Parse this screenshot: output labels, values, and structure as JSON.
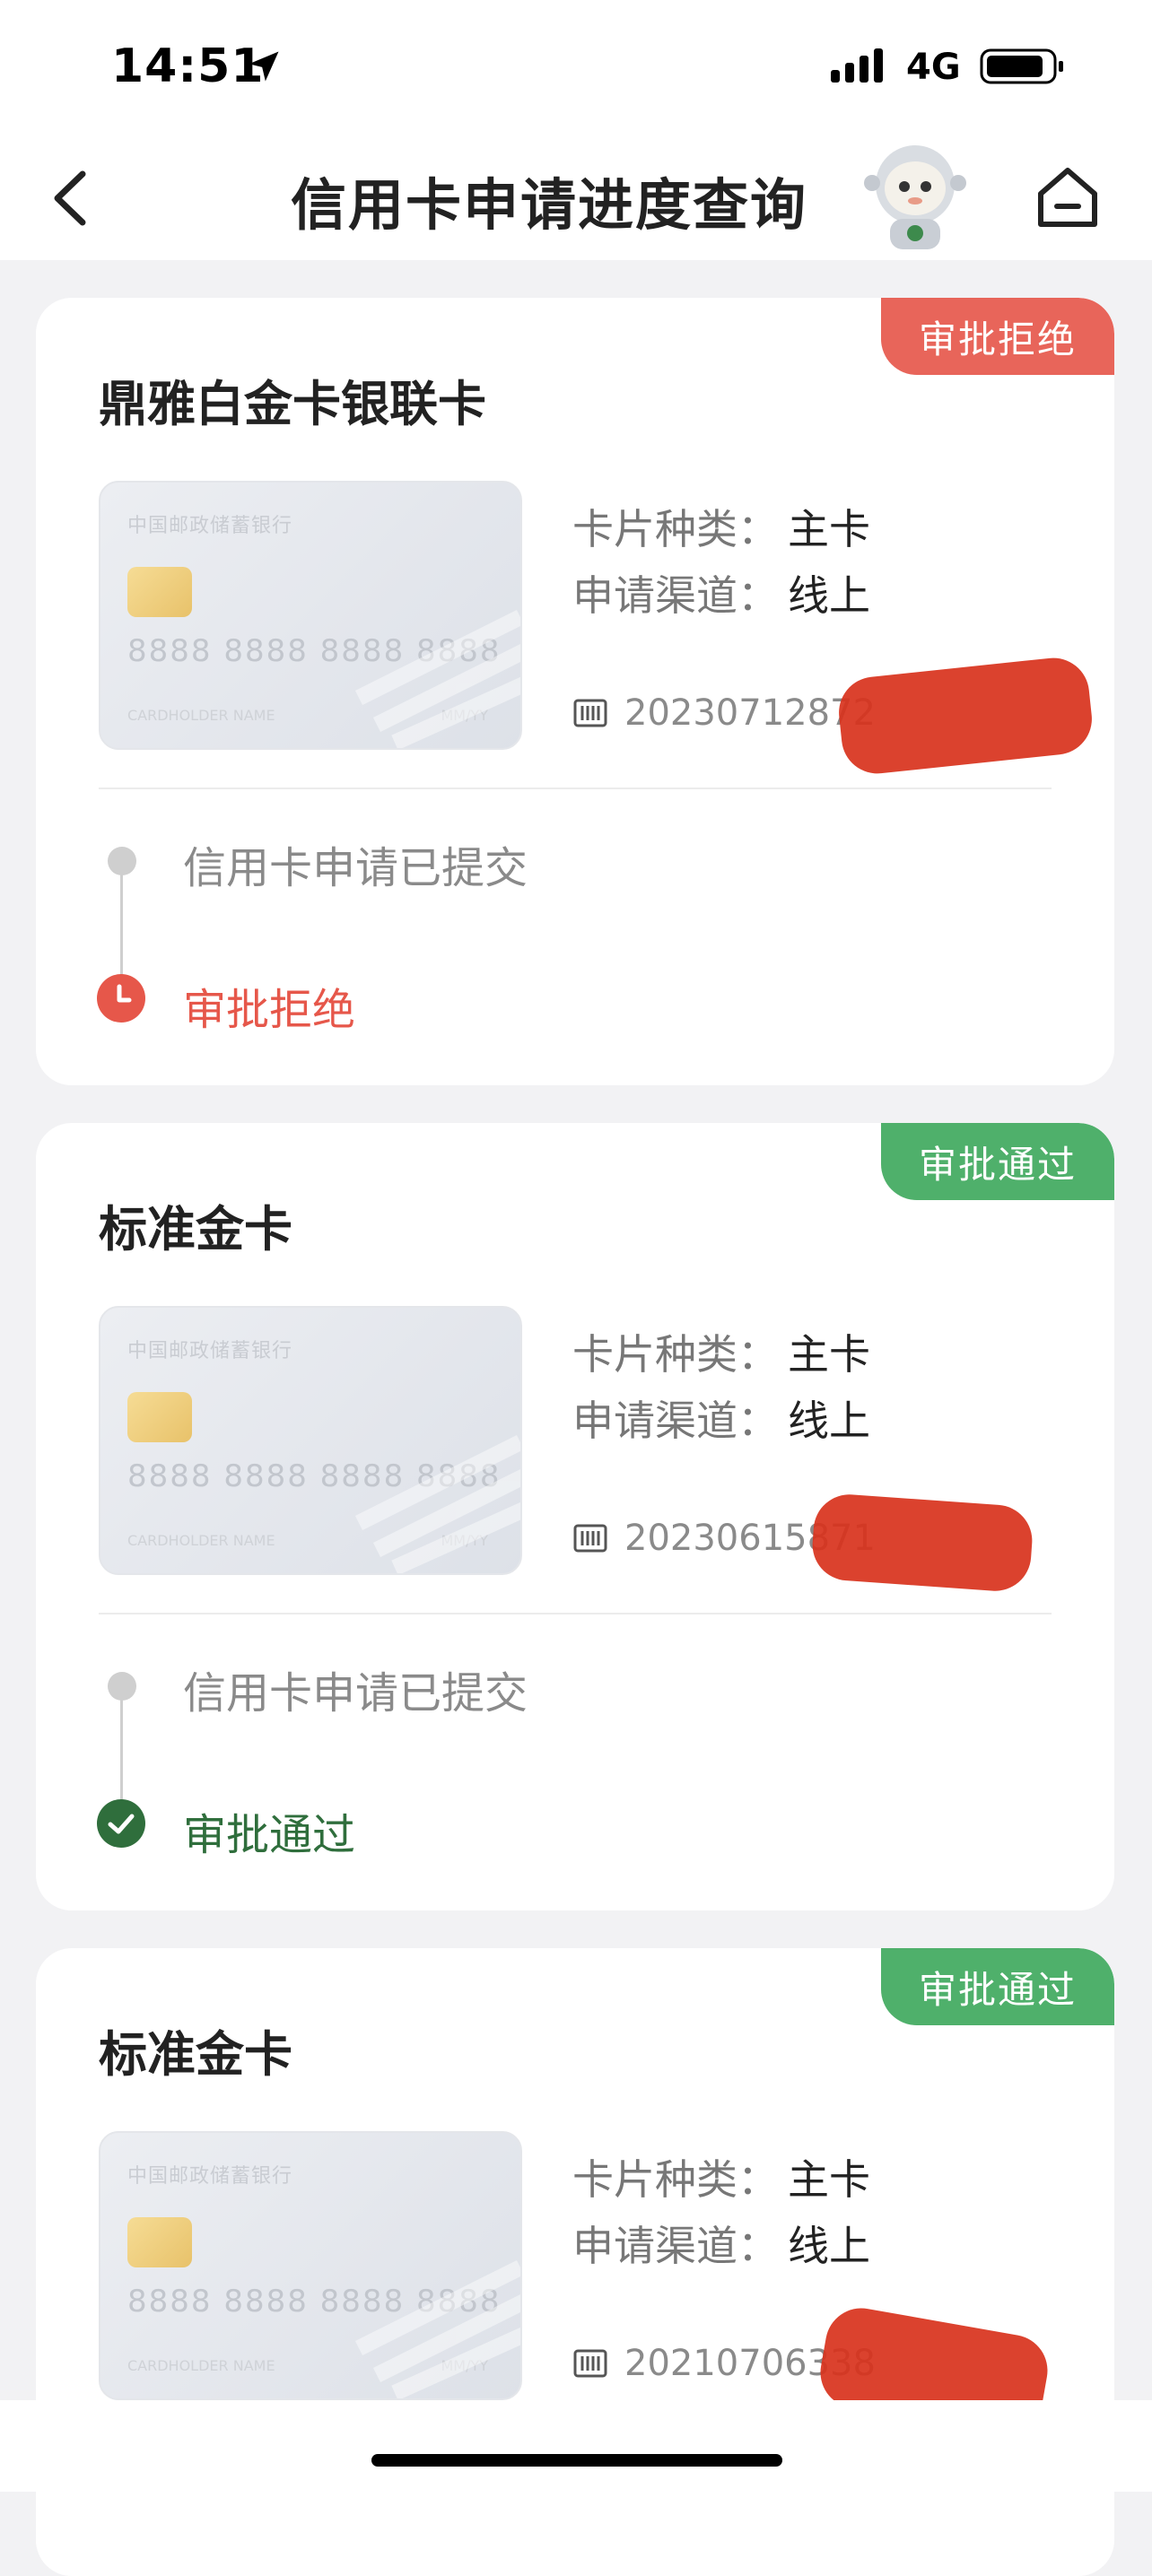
{
  "status_bar": {
    "time": "14:51",
    "network": "4G",
    "icons": [
      "location-arrow-icon",
      "signal-icon",
      "battery-icon"
    ]
  },
  "nav": {
    "title": "信用卡申请进度查询",
    "back_icon": "chevron-left-icon",
    "home_icon": "home-icon",
    "mascot": "mascot-astronaut"
  },
  "colors": {
    "reject": "#e8655a",
    "pass": "#4fb06b",
    "pass_text": "#2f6e3c",
    "redaction": "#d8321c"
  },
  "card_template": {
    "bank_name": "中国邮政储蓄银行",
    "number": "8888 8888 8888 8888",
    "holder": "CARDHOLDER NAME",
    "expiry": "MM/YY"
  },
  "labels": {
    "card_type": "卡片种类：",
    "channel": "申请渠道："
  },
  "applications": [
    {
      "status": "审批拒绝",
      "status_type": "reject",
      "card_name": "鼎雅白金卡银联卡",
      "card_type": "主卡",
      "channel": "线上",
      "app_no_visible": "20230712872",
      "steps": [
        "信用卡申请已提交",
        "审批拒绝"
      ]
    },
    {
      "status": "审批通过",
      "status_type": "pass",
      "card_name": "标准金卡",
      "card_type": "主卡",
      "channel": "线上",
      "app_no_visible": "20230615871",
      "steps": [
        "信用卡申请已提交",
        "审批通过"
      ]
    },
    {
      "status": "审批通过",
      "status_type": "pass",
      "card_name": "标准金卡",
      "card_type": "主卡",
      "channel": "线上",
      "app_no_visible": "20210706338",
      "steps": []
    }
  ]
}
